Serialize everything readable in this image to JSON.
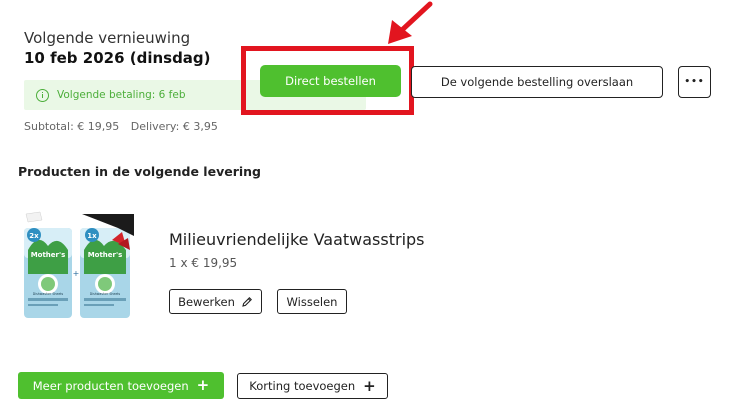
{
  "renewal": {
    "label": "Volgende vernieuwing",
    "date": "10 feb 2026 (dinsdag)"
  },
  "payment": {
    "icon": "info-icon",
    "text": "Volgende betaling: 6 feb"
  },
  "totals": {
    "subtotal": "Subtotal: € 19,95",
    "delivery": "Delivery: € 3,95"
  },
  "actions": {
    "order_now": "Direct bestellen",
    "skip_next": "De volgende bestelling overslaan",
    "more": "•••"
  },
  "products_section": {
    "title": "Producten in de volgende levering",
    "items": [
      {
        "name": "Milieuvriendelijke Vaatwasstrips",
        "quantity_price": "1 x € 19,95",
        "edit_label": "Bewerken",
        "swap_label": "Wisselen",
        "image": {
          "left_badge": "2x",
          "right_badge": "1x",
          "brand": "Mother's",
          "product_text": "Dishwasher Sheets"
        }
      }
    ]
  },
  "footer": {
    "add_products": "Meer producten toevoegen",
    "add_discount": "Korting toevoegen"
  },
  "colors": {
    "primary_green": "#4fc02f",
    "info_green": "#4cae3a",
    "info_bg": "#eaf8e6",
    "highlight_red": "#e2151f"
  }
}
